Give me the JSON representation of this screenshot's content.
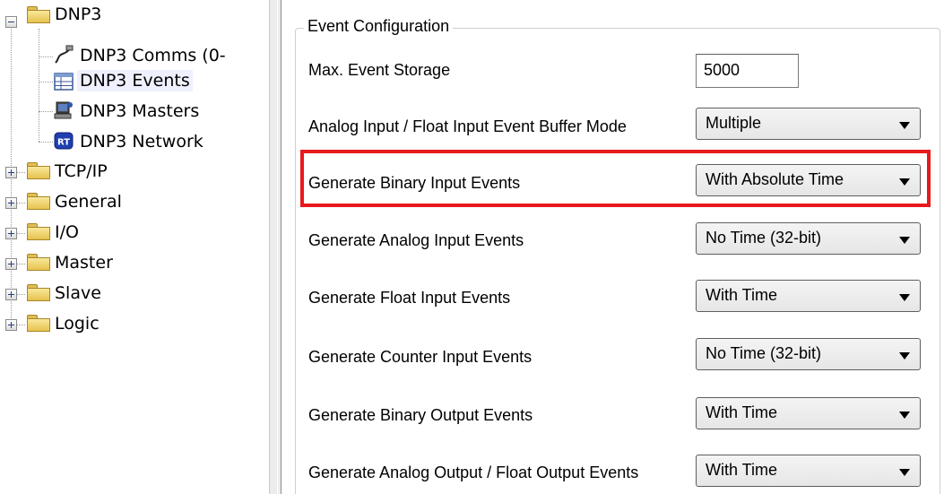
{
  "tree": {
    "dnp3": {
      "label": "DNP3"
    },
    "dnp3_comms": {
      "label": "DNP3 Comms (0-"
    },
    "dnp3_events": {
      "label": "DNP3 Events"
    },
    "dnp3_masters": {
      "label": "DNP3 Masters"
    },
    "dnp3_network": {
      "label": "DNP3 Network"
    },
    "tcpip": {
      "label": "TCP/IP"
    },
    "general": {
      "label": "General"
    },
    "io": {
      "label": "I/O"
    },
    "master": {
      "label": "Master"
    },
    "slave": {
      "label": "Slave"
    },
    "logic": {
      "label": "Logic"
    },
    "icons": [
      "folder-icon",
      "cable-icon",
      "table-icon",
      "computer-icon",
      "rt-icon"
    ]
  },
  "panel": {
    "group_title": "Event Configuration",
    "max_event_storage": {
      "label": "Max. Event Storage",
      "value": "5000"
    },
    "fields": [
      {
        "label": "Analog Input / Float Input Event Buffer Mode",
        "value": "Multiple"
      },
      {
        "label": "Generate Binary Input Events",
        "value": "With Absolute Time"
      },
      {
        "label": "Generate Analog Input Events",
        "value": "No Time (32-bit)"
      },
      {
        "label": "Generate Float Input Events",
        "value": "With Time"
      },
      {
        "label": "Generate Counter Input Events",
        "value": "No Time (32-bit)"
      },
      {
        "label": "Generate Binary Output Events",
        "value": "With Time"
      },
      {
        "label": "Generate Analog Output / Float Output Events",
        "value": "With Time"
      }
    ]
  },
  "colors": {
    "highlight": "#e8191c",
    "folder": "#f0cf6a",
    "selection": "#eef0ff"
  }
}
